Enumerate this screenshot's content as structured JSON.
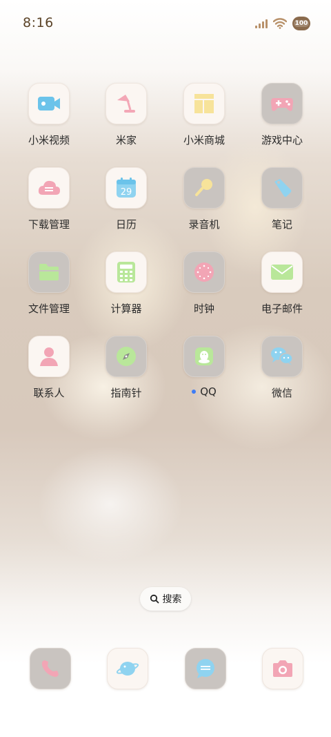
{
  "status_bar": {
    "time": "8:16",
    "battery": "100",
    "icons": [
      "signal-icon",
      "wifi-icon",
      "battery-dog-icon"
    ]
  },
  "apps": [
    {
      "label": "小米视频",
      "icon": "video-camera-icon"
    },
    {
      "label": "米家",
      "icon": "lamp-icon"
    },
    {
      "label": "小米商城",
      "icon": "store-icon"
    },
    {
      "label": "游戏中心",
      "icon": "gamepad-icon"
    },
    {
      "label": "下载管理",
      "icon": "cloud-download-icon"
    },
    {
      "label": "日历",
      "icon": "calendar-icon",
      "day": "29"
    },
    {
      "label": "录音机",
      "icon": "microphone-icon"
    },
    {
      "label": "笔记",
      "icon": "note-tag-icon"
    },
    {
      "label": "文件管理",
      "icon": "folder-icon"
    },
    {
      "label": "计算器",
      "icon": "calculator-icon"
    },
    {
      "label": "时钟",
      "icon": "clock-icon"
    },
    {
      "label": "电子邮件",
      "icon": "mail-icon"
    },
    {
      "label": "联系人",
      "icon": "contact-icon"
    },
    {
      "label": "指南针",
      "icon": "compass-icon"
    },
    {
      "label": "QQ",
      "icon": "qq-penguin-icon",
      "new_badge": true
    },
    {
      "label": "微信",
      "icon": "wechat-icon"
    }
  ],
  "search": {
    "label": "搜索",
    "icon": "search-icon"
  },
  "dock": [
    {
      "name": "phone",
      "icon": "phone-icon"
    },
    {
      "name": "browser",
      "icon": "browser-icon"
    },
    {
      "name": "messages",
      "icon": "messages-icon"
    },
    {
      "name": "camera",
      "icon": "camera-icon"
    }
  ],
  "colors": {
    "label_text": "#2b2b2b",
    "time_text": "#5a4226",
    "notification_dot": "#3e7cf5",
    "icon_frame": "#fbf6f2",
    "icon_frame_gray": "#c9c4c0"
  }
}
